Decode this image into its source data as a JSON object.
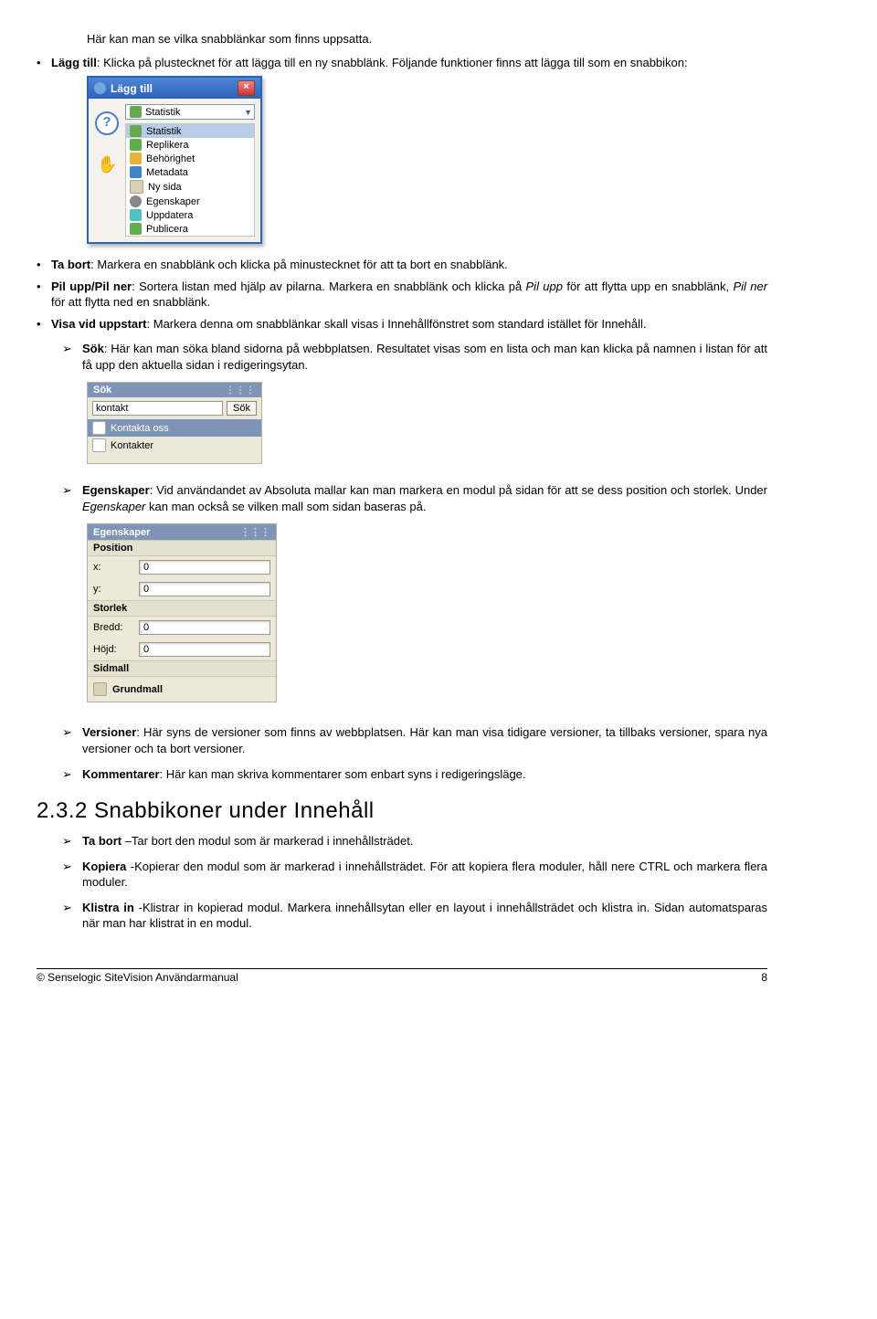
{
  "intro": {
    "line1": "Här kan man se vilka snabblänkar som finns uppsatta.",
    "lagg_label": "Lägg till",
    "lagg_text": ": Klicka på plustecknet för att lägga till en ny snabblänk. Följande funktioner finns att lägga till som en snabbikon:"
  },
  "dialog": {
    "title": "Lägg till",
    "selected": "Statistik",
    "items": [
      "Statistik",
      "Replikera",
      "Behörighet",
      "Metadata",
      "Ny sida",
      "Egenskaper",
      "Uppdatera",
      "Publicera"
    ]
  },
  "sub_bullets": {
    "tabort_label": "Ta bort",
    "tabort_text": ": Markera en snabblänk och klicka på minustecknet för att ta bort en snabblänk.",
    "pil_label": "Pil upp/Pil ner",
    "pil_text1": ": Sortera listan med hjälp av pilarna. Markera en snabblänk och klicka på ",
    "pil_i1": "Pil upp",
    "pil_text2": " för att flytta upp en snabblänk, ",
    "pil_i2": "Pil ner",
    "pil_text3": " för att flytta ned en snabblänk.",
    "visa_label": "Visa vid uppstart",
    "visa_text": ": Markera denna om snabblänkar skall visas i Innehållfönstret som standard istället för Innehåll."
  },
  "sok_item": {
    "label": "Sök",
    "text": ": Här kan man söka bland sidorna på webbplatsen. Resultatet visas som en lista och man kan klicka på namnen i listan för att få upp den aktuella sidan i redigeringsytan."
  },
  "sok_panel": {
    "title": "Sök",
    "value": "kontakt",
    "button": "Sök",
    "r1": "Kontakta oss",
    "r2": "Kontakter"
  },
  "egen_item": {
    "label": "Egenskaper",
    "text1": ": Vid användandet av Absoluta mallar kan man markera en modul på sidan för att se dess position och storlek. Under ",
    "em": "Egenskaper",
    "text2": " kan man också se vilken mall som sidan baseras på."
  },
  "egen_panel": {
    "title": "Egenskaper",
    "pos": "Position",
    "x": "x:",
    "xv": "0",
    "y": "y:",
    "yv": "0",
    "stor": "Storlek",
    "bredd": "Bredd:",
    "bv": "0",
    "hojd": "Höjd:",
    "hv": "0",
    "sidmall": "Sidmall",
    "template": "Grundmall"
  },
  "after": {
    "ver_label": "Versioner",
    "ver_text": ": Här syns de versioner som finns av webbplatsen. Här kan man visa tidigare versioner, ta tillbaks versioner, spara nya versioner och ta bort versioner.",
    "kom_label": "Kommentarer",
    "kom_text": ": Här kan man skriva kommentarer som enbart syns i redigeringsläge."
  },
  "heading": "2.3.2 Snabbikoner under Innehåll",
  "snabb": {
    "t1_label": "Ta bort",
    "t1_text": " –Tar bort den modul som är markerad i innehållsträdet.",
    "t2_label": "Kopiera",
    "t2_text": " -Kopierar den modul som är markerad i innehållsträdet. För att kopiera flera moduler, håll nere CTRL och markera flera moduler.",
    "t3_label": "Klistra in",
    "t3_text": " -Klistrar in kopierad modul. Markera innehållsytan eller en layout i innehållsträdet och klistra in. Sidan automatsparas när man har klistrat in en modul."
  },
  "footer": {
    "left": "© Senselogic SiteVision Användarmanual",
    "right": "8"
  }
}
